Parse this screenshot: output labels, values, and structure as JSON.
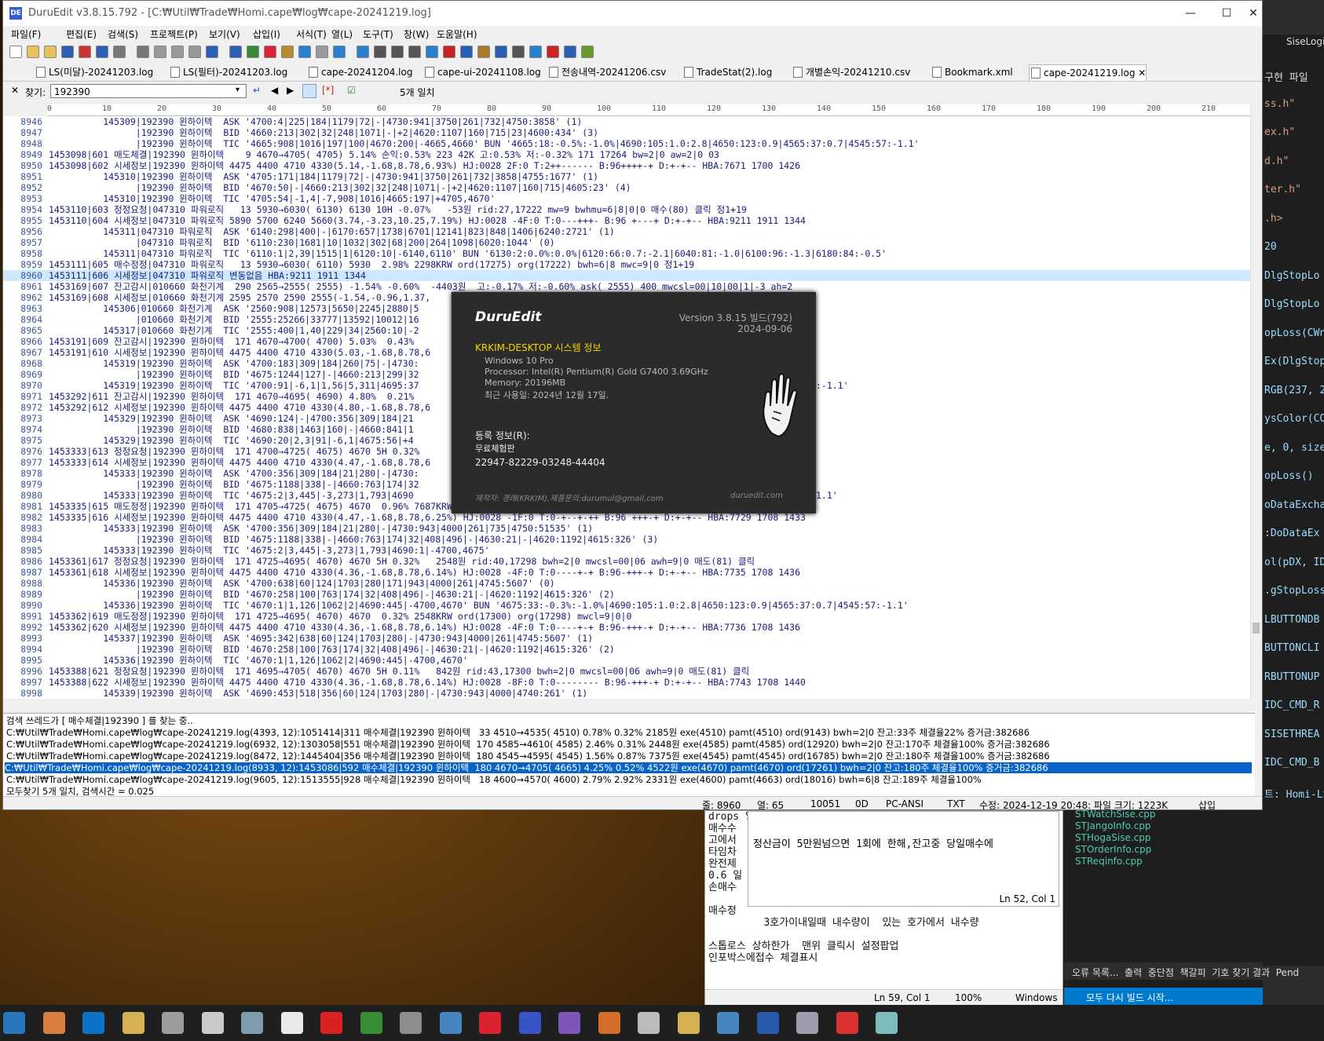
{
  "window": {
    "title": "DuruEdit v3.8.15.792 - [C:₩Util₩Trade₩Homi.cape₩log₩cape-20241219.log]",
    "icon_label": "DE",
    "minimize": "—",
    "maximize": "☐",
    "close": "✕"
  },
  "menu": [
    "파일(F)",
    "편집(E)",
    "검색(S)",
    "프로젝트(P)",
    "보기(V)",
    "삽입(I)",
    "서식(T)",
    "열(L)",
    "도구(T)",
    "창(W)",
    "도움말(H)"
  ],
  "tabs": [
    {
      "label": "LS(미달)-20241203.log"
    },
    {
      "label": "LS(필터)-20241203.log"
    },
    {
      "label": "cape-20241204.log"
    },
    {
      "label": "cape-ui-20241108.log"
    },
    {
      "label": "전송내역-20241206.csv"
    },
    {
      "label": "TradeStat(2).log"
    },
    {
      "label": "개별손익-20241210.csv"
    },
    {
      "label": "Bookmark.xml"
    },
    {
      "label": "cape-20241219.log",
      "active": true
    }
  ],
  "find": {
    "label": "찾기:",
    "value": "192390",
    "result": "5개 일치"
  },
  "ruler": [
    "0",
    "10",
    "20",
    "30",
    "40",
    "50",
    "60",
    "70",
    "80",
    "90",
    "100",
    "110",
    "120",
    "130",
    "140",
    "150",
    "160",
    "170",
    "180",
    "190",
    "200",
    "210"
  ],
  "lines": [
    {
      "n": "8946",
      "t": "          145309|192390 윈하이텍  ASK '4700:4|225|184|1179|72|-|4730:941|3750|261|732|4750:3858' (1)"
    },
    {
      "n": "8947",
      "t": "                |192390 윈하이텍  BID '4660:213|302|32|248|1071|-|+2|4620:1107|160|715|23|4600:434' (3)"
    },
    {
      "n": "8948",
      "t": "                |192390 윈하이텍  TIC '4665:908|1016|197|100|4670:200|-4665,4660' BUN '4665:18:-0.5%:-1.0%|4690:105:1.0:2.8|4650:123:0.9|4565:37:0.7|4545:57:-1.1'"
    },
    {
      "n": "8949",
      "t": "1453098|601 매도체결|192390 윈하이텍    9 4670→4705( 4705) 5.14% 손익:0.53% 223 42K 고:0.53% 저:-0.32% 171 17264 bw=2|0 aw=2|0 03"
    },
    {
      "n": "8950",
      "t": "1453098|602 시세정보|192390 윈하이텍 4475 4400 4710 4330(5.14,-1.68,8.78,6.93%) HJ:0028 2F:0 T:2++------ B:96++++-+ D:+-+-- HBA:7671 1700 1426"
    },
    {
      "n": "8951",
      "t": "          145310|192390 윈하이텍  ASK '4705:171|184|1179|72|-|4730:941|3750|261|732|3858|4755:1677' (1)"
    },
    {
      "n": "8952",
      "t": "                |192390 윈하이텍  BID '4670:50|-|4660:213|302|32|248|1071|-|+2|4620:1107|160|715|4605:23' (4)"
    },
    {
      "n": "8953",
      "t": "          145310|192390 윈하이텍  TIC '4705:54|-1,4|-7,908|1016|4665:197|+4705,4670'"
    },
    {
      "n": "8954",
      "t": "1453110|603 정정요청|047310 파워로직   13 5930→6030( 6130) 6130 10H -0.07%   -53원 rid:27,17222 mw=9 bwhmu=6|8|0|0 매수(80) 클릭 정1+19"
    },
    {
      "n": "8955",
      "t": "1453110|604 시세정보|047310 파워로직 5890 5700 6240 5660(3.74,-3.23,10.25,7.19%) HJ:0028 -4F:0 T:0---+++- B:96 +---+ D:+-+-- HBA:9211 1911 1344"
    },
    {
      "n": "8956",
      "t": "          145311|047310 파워로직  ASK '6140:298|400|-|6170:657|1738|6701|12141|823|848|1406|6240:2721' (1)"
    },
    {
      "n": "8957",
      "t": "                |047310 파워로직  BID '6110:230|1681|10|1032|302|68|200|264|1098|6020:1044' (0)"
    },
    {
      "n": "8958",
      "t": "          145311|047310 파워로직  TIC '6110:1|2,39|1515|1|6120:10|-6140,6110' BUN '6130:2:0.0%:0.0%|6120:66:0.7:-2.1|6040:81:-1.0|6100:96:-1.3|6180:84:-0.5'"
    },
    {
      "n": "8959",
      "t": "1453111|605 매수정정|047310 파워로직   13 5930→6030( 6110) 5930  2.98% 2298KRW ord(17275) org(17222) bwh=6|8 mwc=9|0 정1+19"
    },
    {
      "n": "8960",
      "t": "1453111|606 시세정보|047310 파워로직 변동없음 HBA:9211 1911 1344",
      "hl": true
    },
    {
      "n": "8961",
      "t": "1453169|607 잔고감시|010660 화천기계  290 2565→2555( 2555) -1.54% -0.60%  -4403원  고:-0.17% 저:-0.60% ask( 2555) 400 mwcsl=00|10|00|1|-3 ah=2"
    },
    {
      "n": "8962",
      "t": "1453169|608 시세정보|010660 화천기계 2595 2570 2590 2555(-1.54,-0.96,1.37,                                                              1204"
    },
    {
      "n": "8963",
      "t": "          145306|010660 화천기계  ASK '2560:908|12573|5650|2245|2880|5"
    },
    {
      "n": "8964",
      "t": "                |010660 화천기계  BID '2555:25266|33777|13592|10012|16"
    },
    {
      "n": "8965",
      "t": "          145317|010660 화천기계  TIC '2555:400|1,40|229|34|2560:10|-2                                                   0|2565:4:0.2'"
    },
    {
      "n": "8966",
      "t": "1453191|609 잔고감시|192390 윈하이텍  171 4670→4700( 4700) 5.03%  0.43%                                                   0 ah=0"
    },
    {
      "n": "8967",
      "t": "1453191|610 시세정보|192390 윈하이텍 4475 4400 4710 4330(5.03,-1.68,8.78,6                                                   29"
    },
    {
      "n": "8968",
      "t": "          145319|192390 윈하이텍  ASK '4700:183|309|184|260|75|-|4730:"
    },
    {
      "n": "8969",
      "t": "                |192390 윈하이텍  BID '4675:1244|127|-|4660:213|299|32"
    },
    {
      "n": "8970",
      "t": "          145319|192390 윈하이텍  TIC '4700:91|-6,1|1,56|5,311|4695:37                                                    9|4565:37:0.7|4545:57:-1.1'"
    },
    {
      "n": "8971",
      "t": "1453292|611 잔고감시|192390 윈하이텍  171 4670→4695( 4690) 4.80%  0.21%                                                   0 ah=0"
    },
    {
      "n": "8972",
      "t": "1453292|612 시세정보|192390 윈하이텍 4475 4400 4710 4330(4.80,-1.68,8.78,6                                                   29"
    },
    {
      "n": "8973",
      "t": "          145329|192390 윈하이텍  ASK '4690:124|-|4700:356|309|184|21"
    },
    {
      "n": "8974",
      "t": "                |192390 윈하이텍  BID '4680:838|1463|160|-|4660:841|1"
    },
    {
      "n": "8975",
      "t": "          145329|192390 윈하이텍  TIC '4690:20|2,3|91|-6,1|4675:56|+4                                                   5:37:0.7|4545:57:-1.1'"
    },
    {
      "n": "8976",
      "t": "1453333|613 정정요청|192390 윈하이텍  171 4700→4725( 4675) 4670 5H 0.32%"
    },
    {
      "n": "8977",
      "t": "1453333|614 시세정보|192390 윈하이텍 4475 4400 4710 4330(4.47,-1.68,8.78,6                                                   433"
    },
    {
      "n": "8978",
      "t": "          145333|192390 윈하이텍  ASK '4700:356|309|184|21|280|-|4730:"
    },
    {
      "n": "8979",
      "t": "                |192390 윈하이텍  BID '4675:1188|338|-|4660:763|174|32"
    },
    {
      "n": "8980",
      "t": "          145333|192390 윈하이텍  TIC '4675:2|3,445|-3,273|1,793|4690                                                   9|4565:37:0.7|4545:57:-1.1'"
    },
    {
      "n": "8981",
      "t": "1453335|615 매도정정|192390 윈하이텍  171 4705→4725( 4675) 4670  0.96% 7687KRW ord(17230) org(17296) mwcl=9|0|0"
    },
    {
      "n": "8982",
      "t": "1453335|616 시세정보|192390 윈하이텍 4475 4400 4710 4330(4.47,-1.68,8.78,6.25%) HJ:0028 -1F:0 T:0-+--+-++ B:96 +++-+ D:+-+-- HBA:7729 1708 1433"
    },
    {
      "n": "8983",
      "t": "          145333|192390 윈하이텍  ASK '4700:356|309|184|21|280|-|4730:943|4000|261|735|4750:51535' (1)"
    },
    {
      "n": "8984",
      "t": "                |192390 윈하이텍  BID '4675:1188|338|-|4660:763|174|32|408|496|-|4630:21|-|4620:1192|4615:326' (3)"
    },
    {
      "n": "8985",
      "t": "          145333|192390 윈하이텍  TIC '4675:2|3,445|-3,273|1,793|4690:1|-4700,4675'"
    },
    {
      "n": "8986",
      "t": "1453361|617 정정요청|192390 윈하이텍  171 4725→4695( 4670) 4670 5H 0.32%   2548원 rid:40,17298 bwh=2|0 mwcsl=00|06 awh=9|0 매도(81) 클릭"
    },
    {
      "n": "8987",
      "t": "1453361|618 시세정보|192390 윈하이텍 4475 4400 4710 4330(4.36,-1.68,8.78,6.14%) HJ:0028 -4F:0 T:0----+-+ B:96-+++-+ D:+-+-- HBA:7735 1708 1436"
    },
    {
      "n": "8988",
      "t": "          145336|192390 윈하이텍  ASK '4700:638|60|124|1703|280|171|943|4000|261|4745:5607' (0)"
    },
    {
      "n": "8989",
      "t": "                |192390 윈하이텍  BID '4670:258|100|763|174|32|408|496|-|4630:21|-|4620:1192|4615:326' (2)"
    },
    {
      "n": "8990",
      "t": "          145336|192390 윈하이텍  TIC '4670:1|1,126|1062|2|4690:445|-4700,4670' BUN '4675:33:-0.3%:-1.0%|4690:105:1.0:2.8|4650:123:0.9|4565:37:0.7|4545:57:-1.1'"
    },
    {
      "n": "8991",
      "t": "1453362|619 매도정정|192390 윈하이텍  171 4725→4695( 4670) 4670  0.32% 2548KRW ord(17300) org(17298) mwcl=9|0|0"
    },
    {
      "n": "8992",
      "t": "1453362|620 시세정보|192390 윈하이텍 4475 4400 4710 4330(4.36,-1.68,8.78,6.14%) HJ:0028 -4F:0 T:0----+-+ B:96-+++-+ D:+-+-- HBA:7736 1708 1436"
    },
    {
      "n": "8993",
      "t": "          145337|192390 윈하이텍  ASK '4695:342|638|60|124|1703|280|-|4730:943|4000|261|4745:5607' (1)"
    },
    {
      "n": "8994",
      "t": "                |192390 윈하이텍  BID '4670:258|100|763|174|32|408|496|-|4630:21|-|4620:1192|4615:326' (2)"
    },
    {
      "n": "8995",
      "t": "          145336|192390 윈하이텍  TIC '4670:1|1,126|1062|2|4690:445|-4700,4670'"
    },
    {
      "n": "8996",
      "t": "1453388|621 정정요청|192390 윈하이텍  171 4695→4705( 4670) 4670 5H 0.11%   842원 rid:43,17300 bwh=2|0 mwcsl=00|06 awh=9|0 매도(81) 클릭"
    },
    {
      "n": "8997",
      "t": "1453388|622 시세정보|192390 윈하이텍 4475 4400 4710 4330(4.36,-1.68,8.78,6.14%) HJ:0028 -8F:0 T:0-------- B:96-+++-+ D:+-+-- HBA:7743 1708 1440"
    },
    {
      "n": "8998",
      "t": "          145339|192390 윈하이텍  ASK '4690:453|518|356|60|124|1703|280|-|4730:943|4000|4740:261' (1)"
    }
  ],
  "results": {
    "header": "검색 쓰레드가 [ 매수체결|192390 ] 를 찾는 중..",
    "rows": [
      "C:₩Util₩Trade₩Homi.cape₩log₩cape-20241219.log(4393, 12):1051414|311 매수체결|192390 윈하이텍   33 4510→4535( 4510) 0.78% 0.32% 2185원 exe(4510) pamt(4510) ord(9143) bwh=2|0 잔고:33주 체결율22% 증거금:382686",
      "C:₩Util₩Trade₩Homi.cape₩log₩cape-20241219.log(6932, 12):1303058|551 매수체결|192390 윈하이텍  170 4585→4610( 4585) 2.46% 0.31% 2448원 exe(4585) pamt(4585) ord(12920) bwh=2|0 잔고:170주 체결율100% 증거금:382686",
      "C:₩Util₩Trade₩Homi.cape₩log₩cape-20241219.log(8472, 12):1445404|356 매수체결|192390 윈하이텍  180 4545→4595( 4545) 1.56% 0.87% 7375원 exe(4545) pamt(4545) ord(16785) bwh=2|0 잔고:180주 체결율100% 증거금:382686",
      "C:₩Util₩Trade₩Homi.cape₩log₩cape-20241219.log(8933, 12):1453086|592 매수체결|192390 윈하이텍  180 4670→4705( 4665) 4.25% 0.52% 4522원 exe(4670) pamt(4670) ord(17261) bwh=2|0 잔고:180주 체결율100% 증거금:382686",
      "C:₩Util₩Trade₩Homi.cape₩log₩cape-20241219.log(9605, 12):1513555|928 매수체결|192390 윈하이텍   18 4600→4570( 4600) 2.79% 2.92% 2331원 exe(4600) pamt(4663) ord(18016) bwh=6|8 잔고:189주 체결율100%"
    ],
    "footer": "모두찾기 5개 일치, 검색시간 = 0.025"
  },
  "status": {
    "line": "줄: 8960",
    "col": "열: 65",
    "offset": "10051",
    "hex": "0D",
    "encoding": "PC-ANSI",
    "type": "TXT",
    "modified": "수정: 2024-12-19 20:48: 파일 크기: 1223K",
    "mode": "삽입"
  },
  "about": {
    "brand": "DuruEdit",
    "version": "Version 3.8.15 빌드(792)",
    "date": "2024-09-06",
    "host": "KRKIM-DESKTOP 시스템 정보",
    "os": "Windows 10 Pro",
    "cpu": "Processor: Intel(R) Pentium(R) Gold G7400 3.69GHz",
    "mem": "Memory: 20196MB",
    "last_used": "최근 사용일: 2024년 12월 17일.",
    "reg_label": "등록 정보(R):",
    "reg_type": "무료체험판",
    "reg_key": "22947-82229-03248-44404",
    "author": "제작자: 경래(KRKIM),제품문의:durumul@gmail.com",
    "site": "duruedit.com"
  },
  "ide": {
    "title": "SiseLogic",
    "code": [
      "구현 파일",
      "ss.h\"",
      "ex.h\"",
      "d.h\"",
      "ter.h\"",
      ".h>",
      "20",
      "DlgStopLo",
      "DlgStopLo",
      "opLoss(CWnd",
      "Ex(DlgStop",
      "RGB(237, 2",
      "ysColor(CO",
      "e, 0, size",
      "opLoss()",
      "oDataExcha",
      ":DoDataEx",
      "ol(pDX, ID",
      ".gStopLoss",
      "LBUTTONDB",
      "BUTTONCLI",
      "RBUTTONUP",
      "IDC_CMD_R",
      "SISETHREA",
      "IDC_CMD_B",
      "트: Homi-LS"
    ]
  },
  "notepad": {
    "lines": [
      "drops 입종매매 일시중지(금속)",
      "매수수",
      "고에서",
      "타임차",
      "완전제",
      "0.6 일",
      "손매수",
      "",
      "매수정",
      "         3호가이내일때 내수량이  있는 호가에서 내수량",
      "",
      "스톱로스 상하한가  맨위 클릭시 설정팝업",
      "인포박스에접수 체결표시"
    ],
    "status_ln": "Ln 59, Col 1",
    "zoom": "100%",
    "eol": "Windows",
    "inner_text": "정산금이 5만원넘으면 1회에 한해,잔고중 당일매수에 ",
    "inner_status": "Ln 52, Col 1"
  },
  "solution": {
    "files": [
      "STWatchSise.cpp",
      "STJangoInfo.cpp",
      "STHogaSise.cpp",
      "STOrderInfo.cpp",
      "STReqinfo.cpp"
    ],
    "tabs": "오류 목록...  출력  중단점  책갈피  기호 찾기 결과  Pend",
    "build": "모두 다시 빌드 시작..."
  }
}
